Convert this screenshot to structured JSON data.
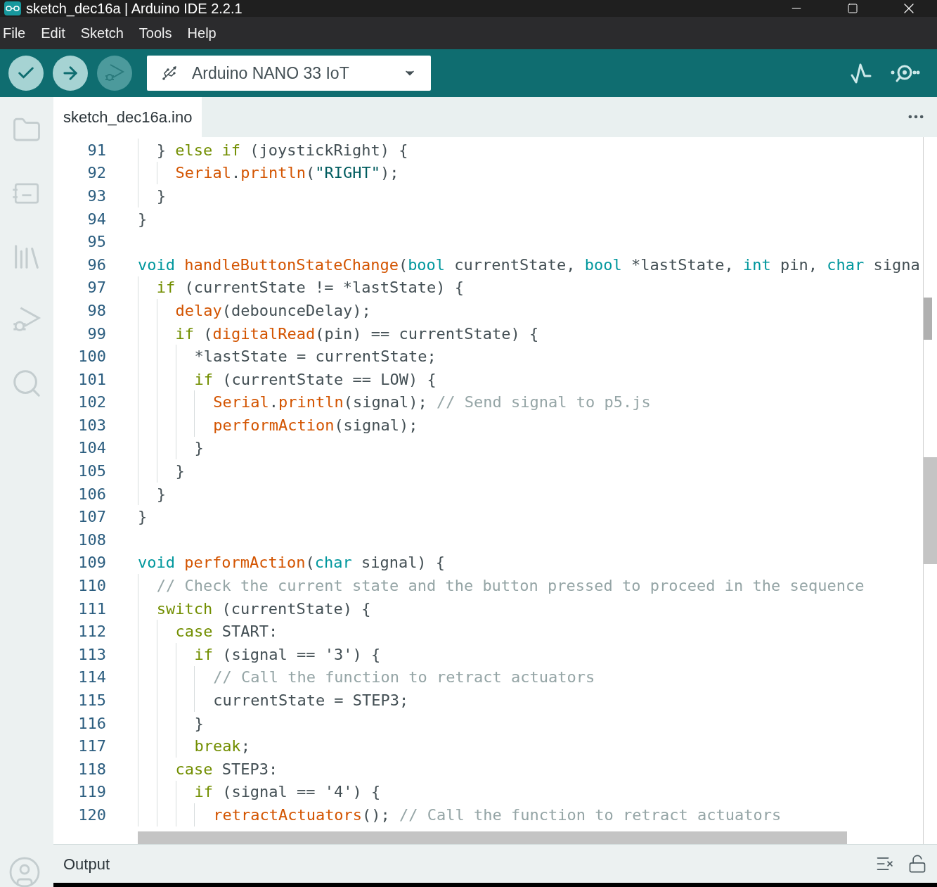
{
  "window": {
    "title": "sketch_dec16a | Arduino IDE 2.2.1"
  },
  "menu": [
    "File",
    "Edit",
    "Sketch",
    "Tools",
    "Help"
  ],
  "toolbar": {
    "buttons": [
      {
        "kind": "verify",
        "disabled": false
      },
      {
        "kind": "upload",
        "disabled": false
      },
      {
        "kind": "debug",
        "disabled": true
      }
    ],
    "board": "Arduino NANO 33 IoT"
  },
  "sidebar": {
    "items": [
      {
        "kind": "folder",
        "selected": false
      },
      {
        "kind": "board",
        "selected": false
      },
      {
        "kind": "library",
        "selected": false
      },
      {
        "kind": "debug",
        "selected": false
      },
      {
        "kind": "search",
        "selected": false
      }
    ]
  },
  "tabs": [
    {
      "label": "sketch_dec16a.ino",
      "selected": true
    }
  ],
  "editor": {
    "lines": [
      {
        "children": [
          {
            "number": "91",
            "tokens": [
              {
                "kind": "plain",
                "text": "} "
              },
              {
                "kind": "kw",
                "text": "else if"
              },
              {
                "kind": "plain",
                "text": " (joystickRight) {"
              }
            ],
            "children": [
              {
                "number": "92",
                "tokens": [
                  {
                    "kind": "fn",
                    "text": "Serial"
                  },
                  {
                    "kind": "plain",
                    "text": "."
                  },
                  {
                    "kind": "fn",
                    "text": "println"
                  },
                  {
                    "kind": "plain",
                    "text": "("
                  },
                  {
                    "kind": "str",
                    "text": "\"RIGHT\""
                  },
                  {
                    "kind": "plain",
                    "text": ");"
                  }
                ]
              }
            ]
          },
          {
            "number": "93",
            "tokens": [
              {
                "kind": "plain",
                "text": "}"
              }
            ]
          }
        ]
      },
      {
        "number": "94",
        "tokens": [
          {
            "kind": "plain",
            "text": "}"
          }
        ]
      },
      {
        "number": "95"
      },
      {
        "number": "96",
        "tokens": [
          {
            "kind": "type",
            "text": "void "
          },
          {
            "kind": "fn",
            "text": "handleButtonStateChange"
          },
          {
            "kind": "plain",
            "text": "("
          },
          {
            "kind": "type",
            "text": "bool"
          },
          {
            "kind": "plain",
            "text": " currentState, "
          },
          {
            "kind": "type",
            "text": "bool"
          },
          {
            "kind": "plain",
            "text": " *lastState, "
          },
          {
            "kind": "type",
            "text": "int"
          },
          {
            "kind": "plain",
            "text": " pin, "
          },
          {
            "kind": "type",
            "text": "char"
          },
          {
            "kind": "plain",
            "text": " signa"
          }
        ],
        "children": [
          {
            "number": "97",
            "tokens": [
              {
                "kind": "kw",
                "text": "if"
              },
              {
                "kind": "plain",
                "text": " (currentState != *lastState) {"
              }
            ],
            "children": [
              {
                "number": "98",
                "tokens": [
                  {
                    "kind": "fn",
                    "text": "delay"
                  },
                  {
                    "kind": "plain",
                    "text": "(debounceDelay);"
                  }
                ]
              },
              {
                "number": "99",
                "tokens": [
                  {
                    "kind": "kw",
                    "text": "if"
                  },
                  {
                    "kind": "plain",
                    "text": " ("
                  },
                  {
                    "kind": "fn",
                    "text": "digitalRead"
                  },
                  {
                    "kind": "plain",
                    "text": "(pin) == currentState) {"
                  }
                ],
                "children": [
                  {
                    "number": "100",
                    "tokens": [
                      {
                        "kind": "plain",
                        "text": "*lastState = currentState;"
                      }
                    ]
                  },
                  {
                    "number": "101",
                    "tokens": [
                      {
                        "kind": "kw",
                        "text": "if"
                      },
                      {
                        "kind": "plain",
                        "text": " (currentState == LOW) {"
                      }
                    ],
                    "children": [
                      {
                        "number": "102",
                        "tokens": [
                          {
                            "kind": "fn",
                            "text": "Serial"
                          },
                          {
                            "kind": "plain",
                            "text": "."
                          },
                          {
                            "kind": "fn",
                            "text": "println"
                          },
                          {
                            "kind": "plain",
                            "text": "(signal); "
                          },
                          {
                            "kind": "cmt",
                            "text": "// Send signal to p5.js"
                          }
                        ]
                      },
                      {
                        "number": "103",
                        "tokens": [
                          {
                            "kind": "fn",
                            "text": "performAction"
                          },
                          {
                            "kind": "plain",
                            "text": "(signal);"
                          }
                        ]
                      }
                    ]
                  },
                  {
                    "number": "104",
                    "tokens": [
                      {
                        "kind": "plain",
                        "text": "}"
                      }
                    ]
                  }
                ]
              },
              {
                "number": "105",
                "tokens": [
                  {
                    "kind": "plain",
                    "text": "}"
                  }
                ]
              }
            ]
          },
          {
            "number": "106",
            "tokens": [
              {
                "kind": "plain",
                "text": "}"
              }
            ]
          }
        ]
      },
      {
        "number": "107",
        "tokens": [
          {
            "kind": "plain",
            "text": "}"
          }
        ]
      },
      {
        "number": "108"
      },
      {
        "number": "109",
        "tokens": [
          {
            "kind": "type",
            "text": "void "
          },
          {
            "kind": "fn",
            "text": "performAction"
          },
          {
            "kind": "plain",
            "text": "("
          },
          {
            "kind": "type",
            "text": "char"
          },
          {
            "kind": "plain",
            "text": " signal) {"
          }
        ],
        "children": [
          {
            "number": "110",
            "tokens": [
              {
                "kind": "cmt",
                "text": "// Check the current state and the button pressed to proceed in the sequence"
              }
            ]
          },
          {
            "number": "111",
            "tokens": [
              {
                "kind": "kw",
                "text": "switch"
              },
              {
                "kind": "plain",
                "text": " (currentState) {"
              }
            ],
            "children": [
              {
                "number": "112",
                "tokens": [
                  {
                    "kind": "kw",
                    "text": "case"
                  },
                  {
                    "kind": "plain",
                    "text": " START:"
                  }
                ],
                "children": [
                  {
                    "number": "113",
                    "tokens": [
                      {
                        "kind": "kw",
                        "text": "if"
                      },
                      {
                        "kind": "plain",
                        "text": " (signal == '3') {"
                      }
                    ],
                    "children": [
                      {
                        "number": "114",
                        "tokens": [
                          {
                            "kind": "cmt",
                            "text": "// Call the function to retract actuators"
                          }
                        ]
                      },
                      {
                        "number": "115",
                        "tokens": [
                          {
                            "kind": "plain",
                            "text": "currentState = STEP3;"
                          }
                        ]
                      }
                    ]
                  },
                  {
                    "number": "116",
                    "tokens": [
                      {
                        "kind": "plain",
                        "text": "}"
                      }
                    ]
                  },
                  {
                    "number": "117",
                    "tokens": [
                      {
                        "kind": "kw",
                        "text": "break"
                      },
                      {
                        "kind": "plain",
                        "text": ";"
                      }
                    ]
                  }
                ]
              },
              {
                "number": "118",
                "tokens": [
                  {
                    "kind": "kw",
                    "text": "case"
                  },
                  {
                    "kind": "plain",
                    "text": " STEP3:"
                  }
                ],
                "children": [
                  {
                    "number": "119",
                    "tokens": [
                      {
                        "kind": "kw",
                        "text": "if"
                      },
                      {
                        "kind": "plain",
                        "text": " (signal == '4') {"
                      }
                    ],
                    "children": [
                      {
                        "number": "120",
                        "tokens": [
                          {
                            "kind": "fn",
                            "text": "retractActuators"
                          },
                          {
                            "kind": "plain",
                            "text": "(); "
                          },
                          {
                            "kind": "cmt",
                            "text": "// Call the function to retract actuators"
                          }
                        ]
                      }
                    ]
                  }
                ]
              }
            ]
          }
        ]
      }
    ]
  },
  "output": {
    "label": "Output"
  }
}
